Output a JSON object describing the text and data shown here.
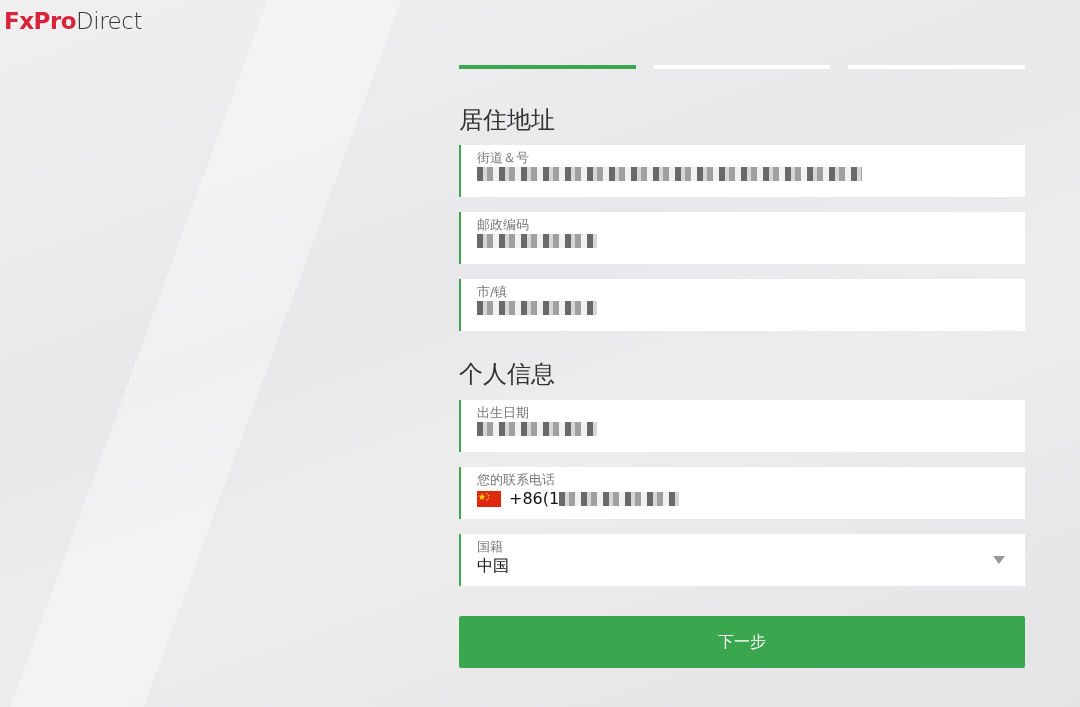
{
  "logo": {
    "part_1": "FxPro",
    "part_2": "Direct"
  },
  "steps": [
    {
      "selected": true
    },
    {
      "selected": false
    },
    {
      "selected": false
    }
  ],
  "sections": [
    {
      "title": "居住地址",
      "fields": [
        {
          "kind": "text",
          "label": "街道＆号",
          "redacted": true
        },
        {
          "kind": "text",
          "label": "邮政编码",
          "redacted": true
        },
        {
          "kind": "text",
          "label": "市/镇",
          "redacted": true
        }
      ]
    },
    {
      "title": "个人信息",
      "fields": [
        {
          "kind": "text",
          "label": "出生日期",
          "redacted": true
        },
        {
          "kind": "phone",
          "label": "您的联系电话",
          "value": "+86(1",
          "redacted": true
        },
        {
          "kind": "select",
          "label": "国籍",
          "value": "中国",
          "redacted": false
        }
      ]
    }
  ],
  "next_button": "下一步"
}
